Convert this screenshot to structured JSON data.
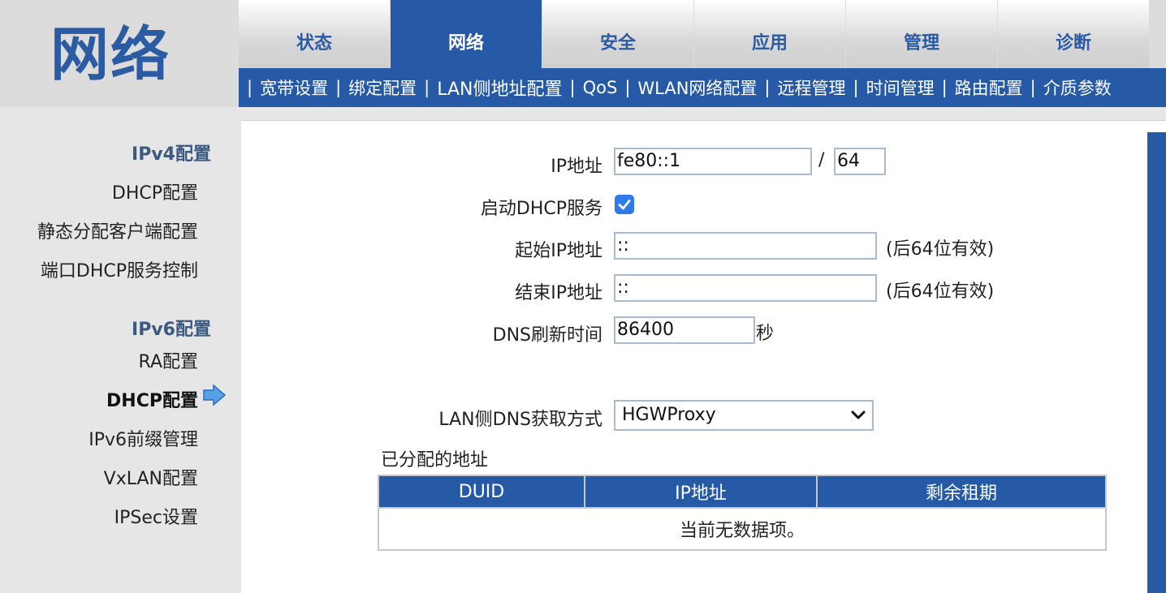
{
  "header": {
    "logo_title": "网络",
    "main_tabs": [
      {
        "label": "状态"
      },
      {
        "label": "网络"
      },
      {
        "label": "安全"
      },
      {
        "label": "应用"
      },
      {
        "label": "管理"
      },
      {
        "label": "诊断"
      }
    ],
    "active_main_tab": "网络",
    "sub_tab_separator": "|",
    "sub_tabs": [
      {
        "label": "宽带设置"
      },
      {
        "label": "绑定配置"
      },
      {
        "label": "LAN侧地址配置"
      },
      {
        "label": "QoS"
      },
      {
        "label": "WLAN网络配置"
      },
      {
        "label": "远程管理"
      },
      {
        "label": "时间管理"
      },
      {
        "label": "路由配置"
      },
      {
        "label": "介质参数"
      }
    ],
    "active_sub_tab": "LAN侧地址配置"
  },
  "sidebar": {
    "ipv4_group": "IPv4配置",
    "ipv4_items": [
      {
        "label": "DHCP配置"
      },
      {
        "label": "静态分配客户端配置"
      },
      {
        "label": "端口DHCP服务控制"
      }
    ],
    "ipv6_group": "IPv6配置",
    "ipv6_items": [
      {
        "label": "RA配置"
      },
      {
        "label": "DHCP配置"
      },
      {
        "label": "IPv6前缀管理"
      },
      {
        "label": "VxLAN配置"
      },
      {
        "label": "IPSec设置"
      }
    ],
    "active_item": "DHCP配置",
    "active_icon": "arrow-right-icon"
  },
  "form": {
    "ip_label": "IP地址",
    "ip_value": "fe80::1",
    "prefix_sep": "/",
    "prefix_value": "64",
    "dhcp_label": "启动DHCP服务",
    "dhcp_enabled": true,
    "start_label": "起始IP地址",
    "start_value": "::",
    "start_note": "(后64位有效)",
    "end_label": "结束IP地址",
    "end_value": "::",
    "end_note": "(后64位有效)",
    "dns_refresh_label": "DNS刷新时间",
    "dns_refresh_value": "86400",
    "dns_refresh_unit": "秒",
    "dns_mode_label": "LAN侧DNS获取方式",
    "dns_mode_value": "HGWProxy"
  },
  "leases": {
    "title": "已分配的地址",
    "columns": [
      "DUID",
      "IP地址",
      "剩余租期"
    ],
    "empty_text": "当前无数据项。"
  },
  "colors": {
    "brand_blue": "#2659a6",
    "checkbox_blue": "#2f7ae8"
  }
}
